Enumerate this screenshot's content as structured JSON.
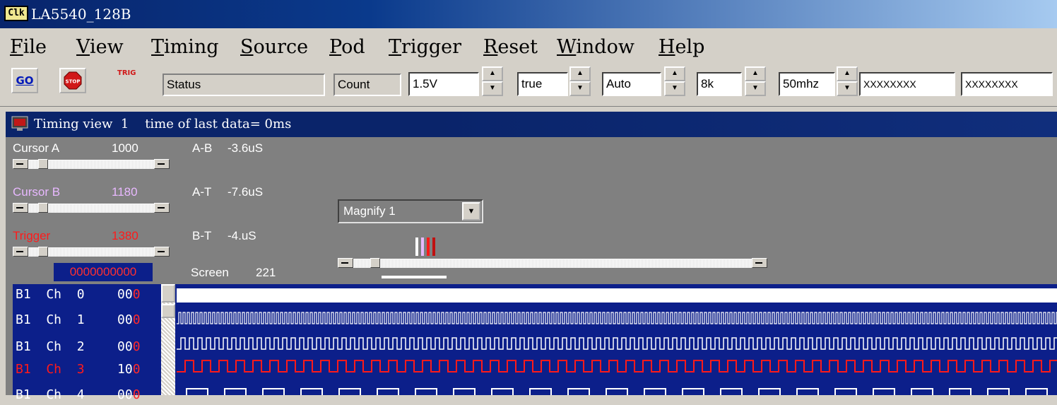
{
  "window": {
    "title": "LA5540_128B",
    "icon_text": "Clk",
    "icon": "clk-app-icon"
  },
  "menu": [
    {
      "label": "File",
      "u": "F",
      "rest": "ile"
    },
    {
      "label": "View",
      "u": "V",
      "rest": "iew"
    },
    {
      "label": "Timing",
      "u": "T",
      "rest": "iming"
    },
    {
      "label": "Source",
      "u": "S",
      "rest": "ource"
    },
    {
      "label": "Pod",
      "u": "P",
      "rest": "od"
    },
    {
      "label": "Trigger",
      "u": "T",
      "rest": "rigger"
    },
    {
      "label": "Reset",
      "u": "R",
      "rest": "eset"
    },
    {
      "label": "Window",
      "u": "W",
      "rest": "indow"
    },
    {
      "label": "Help",
      "u": "H",
      "rest": "elp"
    }
  ],
  "toolbar": {
    "go_label": "GO",
    "stop_label": "STOP",
    "trig_label": "TRIG",
    "status": "Status",
    "count": "Count",
    "voltage": "1.5V",
    "mode": "true",
    "auto": "Auto",
    "depth": "8k",
    "rate": "50mhz",
    "pattern1": "XXXXXXXX",
    "pattern2": "XXXXXXXX"
  },
  "timing_view": {
    "title": "Timing view  1    time of last data= 0ms",
    "icon": "monitor-icon",
    "cursor_a": {
      "label": "Cursor A",
      "value": "1000",
      "color": "#ffffff"
    },
    "cursor_b": {
      "label": "Cursor B",
      "value": "1180",
      "color": "#e8b8ff"
    },
    "trigger": {
      "label": "Trigger",
      "value": "1380",
      "color": "#ff1a1a"
    },
    "ab_label": "A-B",
    "ab_value": "-3.6uS",
    "at_label": "A-T",
    "at_value": "-7.6uS",
    "bt_label": "B-T",
    "bt_value": "-4.uS",
    "magnify": "Magnify 1",
    "position_field": "0000000000",
    "screen_label": "Screen",
    "screen_value": "221"
  },
  "channels": [
    {
      "name": "B1  Ch  0",
      "value": "000",
      "color": "#ffffff",
      "red": false
    },
    {
      "name": "B1  Ch  1",
      "value": "000",
      "color": "#ffffff",
      "red": false
    },
    {
      "name": "B1  Ch  2",
      "value": "000",
      "color": "#ffffff",
      "red": false
    },
    {
      "name": "B1  Ch  3",
      "value": "100",
      "color": "#ff1a1a",
      "red": true
    },
    {
      "name": "B1  Ch  4",
      "value": "000",
      "color": "#ffffff",
      "red": false
    }
  ]
}
